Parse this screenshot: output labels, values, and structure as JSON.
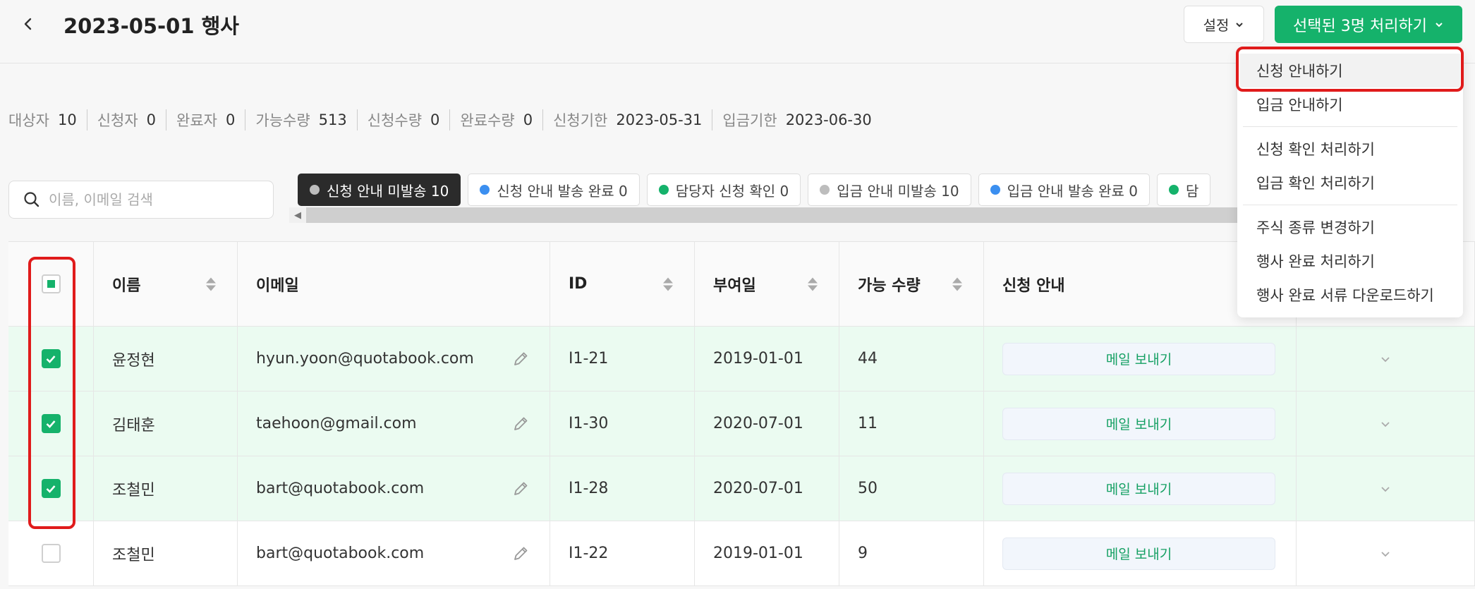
{
  "header": {
    "title": "2023-05-01 행사",
    "settings_label": "설정",
    "process_label": "선택된 3명 처리하기"
  },
  "stats": [
    {
      "label": "대상자",
      "value": "10"
    },
    {
      "label": "신청자",
      "value": "0"
    },
    {
      "label": "완료자",
      "value": "0"
    },
    {
      "label": "가능수량",
      "value": "513"
    },
    {
      "label": "신청수량",
      "value": "0"
    },
    {
      "label": "완료수량",
      "value": "0"
    },
    {
      "label": "신청기한",
      "value": "2023-05-31"
    },
    {
      "label": "입금기한",
      "value": "2023-06-30"
    }
  ],
  "search": {
    "placeholder": "이름, 이메일 검색"
  },
  "chips": [
    {
      "label": "신청 안내 미발송 10",
      "color": "#bdbdbd"
    },
    {
      "label": "신청 안내 발송 완료 0",
      "color": "#3b8ff0"
    },
    {
      "label": "담당자 신청 확인 0",
      "color": "#15b26b"
    },
    {
      "label": "입금 안내 미발송 10",
      "color": "#bdbdbd"
    },
    {
      "label": "입금 안내 발송 완료 0",
      "color": "#3b8ff0"
    },
    {
      "label": "담",
      "color": "#15b26b"
    }
  ],
  "table": {
    "columns": {
      "name": "이름",
      "email": "이메일",
      "id": "ID",
      "grant_date": "부여일",
      "qty": "가능 수량",
      "guide": "신청 안내"
    },
    "rows": [
      {
        "name": "윤정현",
        "email": "hyun.yoon@quotabook.com",
        "id": "I1-21",
        "date": "2019-01-01",
        "qty": "44",
        "action": "메일 보내기",
        "checked": true
      },
      {
        "name": "김태훈",
        "email": "taehoon@gmail.com",
        "id": "I1-30",
        "date": "2020-07-01",
        "qty": "11",
        "action": "메일 보내기",
        "checked": true
      },
      {
        "name": "조철민",
        "email": "bart@quotabook.com",
        "id": "I1-28",
        "date": "2020-07-01",
        "qty": "50",
        "action": "메일 보내기",
        "checked": true
      },
      {
        "name": "조철민",
        "email": "bart@quotabook.com",
        "id": "I1-22",
        "date": "2019-01-01",
        "qty": "9",
        "action": "메일 보내기",
        "checked": false
      }
    ]
  },
  "menu": {
    "group1": [
      "신청 안내하기",
      "입금 안내하기"
    ],
    "group2": [
      "신청 확인 처리하기",
      "입금 확인 처리하기"
    ],
    "group3": [
      "주식 종류 변경하기",
      "행사 완료 처리하기",
      "행사 완료 서류 다운로드하기"
    ]
  },
  "colors": {
    "accent": "#15b26b",
    "highlight": "#e01b1b"
  }
}
